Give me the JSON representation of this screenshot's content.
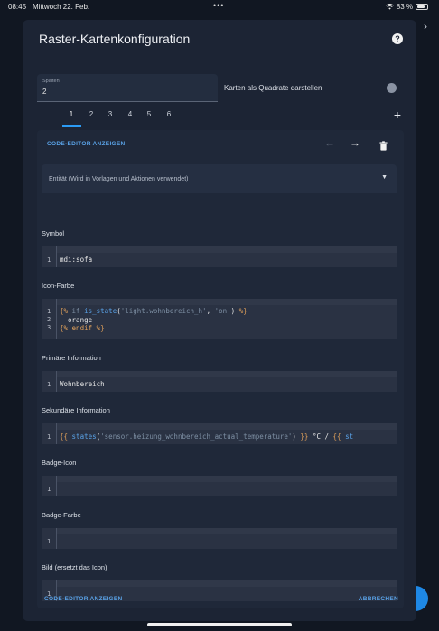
{
  "status_bar": {
    "time": "08:45",
    "date": "Mittwoch 22. Feb.",
    "dots": "•••",
    "battery": "83 %",
    "battery_level": 0.83
  },
  "dialog": {
    "title": "Raster-Kartenkonfiguration",
    "columns": {
      "label": "Spalten",
      "value": "2"
    },
    "square_toggle_label": "Karten als Quadrate darstellen",
    "tabs": [
      "1",
      "2",
      "3",
      "4",
      "5",
      "6"
    ],
    "active_tab": "1",
    "editor": {
      "code_editor_button": "CODE-EDITOR ANZEIGEN",
      "entity_placeholder": "Entität (Wird in Vorlagen und Aktionen verwendet)",
      "sections": {
        "symbol": {
          "label": "Symbol",
          "lines": [
            "1"
          ],
          "value": "mdi:sofa"
        },
        "icon_color": {
          "label": "Icon-Farbe",
          "lines": [
            "1",
            "2",
            "3"
          ],
          "code": {
            "l1_open": "{%",
            "l1_if": " if ",
            "l1_fn": "is_state",
            "l1_p1": "(",
            "l1_s1": "'light.wohnbereich_h'",
            "l1_comma": ", ",
            "l1_s2": "'on'",
            "l1_p2": ") ",
            "l1_close": "%}",
            "l2": "  orange",
            "l3": "{% endif %}"
          }
        },
        "primary": {
          "label": "Primäre Information",
          "lines": [
            "1"
          ],
          "value": "Wohnbereich"
        },
        "secondary": {
          "label": "Sekundäre Information",
          "lines": [
            "1"
          ],
          "code": {
            "open": "{{",
            "fn": " states",
            "p1": "(",
            "str": "'sensor.heizung_wohnbereich_actual_temperature'",
            "p2": ") ",
            "close": "}}",
            "unit": " °C / ",
            "open2": "{{",
            "fn2": " st"
          }
        },
        "badge_icon": {
          "label": "Badge-Icon",
          "lines": [
            "1"
          ]
        },
        "badge_color": {
          "label": "Badge-Farbe",
          "lines": [
            "1"
          ]
        },
        "image": {
          "label": "Bild (ersetzt das Icon)",
          "lines": [
            "1"
          ]
        }
      }
    },
    "footer": {
      "code_editor": "CODE-EDITOR ANZEIGEN",
      "cancel": "ABBRECHEN"
    }
  },
  "colors": {
    "accent": "#2b9af3",
    "dialog_bg": "#1c2434",
    "code_bg": "#2a3243"
  }
}
